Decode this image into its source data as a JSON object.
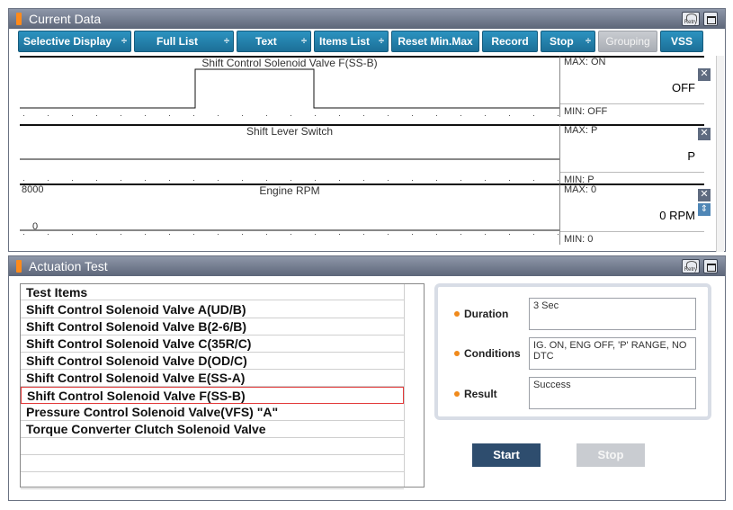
{
  "current_data": {
    "title": "Current Data",
    "retry_label": "Retry",
    "toolbar": {
      "selective_display": "Selective Display",
      "full_list": "Full List",
      "text": "Text",
      "items_list": "Items List",
      "reset_min_max": "Reset Min.Max",
      "record": "Record",
      "stop": "Stop",
      "grouping": "Grouping",
      "vss": "VSS",
      "spin_glyph": "÷"
    },
    "graphs": [
      {
        "title": "Shift Control Solenoid Valve F(SS-B)",
        "max": "MAX: ON",
        "min": "MIN: OFF",
        "value": "OFF",
        "scale_top": "",
        "scale_bottom": ""
      },
      {
        "title": "Shift Lever Switch",
        "max": "MAX: P",
        "min": "MIN: P",
        "value": "P",
        "scale_top": "",
        "scale_bottom": ""
      },
      {
        "title": "Engine RPM",
        "max": "MAX: 0",
        "min": "MIN: 0",
        "value": "0 RPM",
        "scale_top": "8000",
        "scale_bottom": "0"
      }
    ],
    "close_glyph": "✕",
    "scroll_glyph": "⇕"
  },
  "actuation_test": {
    "title": "Actuation Test",
    "retry_label": "Retry",
    "list_header": "Test Items",
    "items": [
      "Shift Control Solenoid Valve A(UD/B)",
      "Shift Control Solenoid Valve B(2-6/B)",
      "Shift Control Solenoid Valve C(35R/C)",
      "Shift Control Solenoid Valve D(OD/C)",
      "Shift Control Solenoid Valve E(SS-A)",
      "Shift Control Solenoid Valve F(SS-B)",
      "Pressure Control Solenoid Valve(VFS) \"A\"",
      "Torque Converter Clutch Solenoid Valve",
      "",
      "",
      ""
    ],
    "selected_index": 5,
    "duration_label": "Duration",
    "duration_value": "3 Sec",
    "conditions_label": "Conditions",
    "conditions_value": "IG. ON, ENG OFF, 'P' RANGE, NO DTC",
    "result_label": "Result",
    "result_value": "Success",
    "start_label": "Start",
    "stop_label": "Stop"
  },
  "colors": {
    "accent": "#1c6f97",
    "title_bar": "#6f788a",
    "marker": "#ff8a1a",
    "selected": "#e23a3a"
  }
}
